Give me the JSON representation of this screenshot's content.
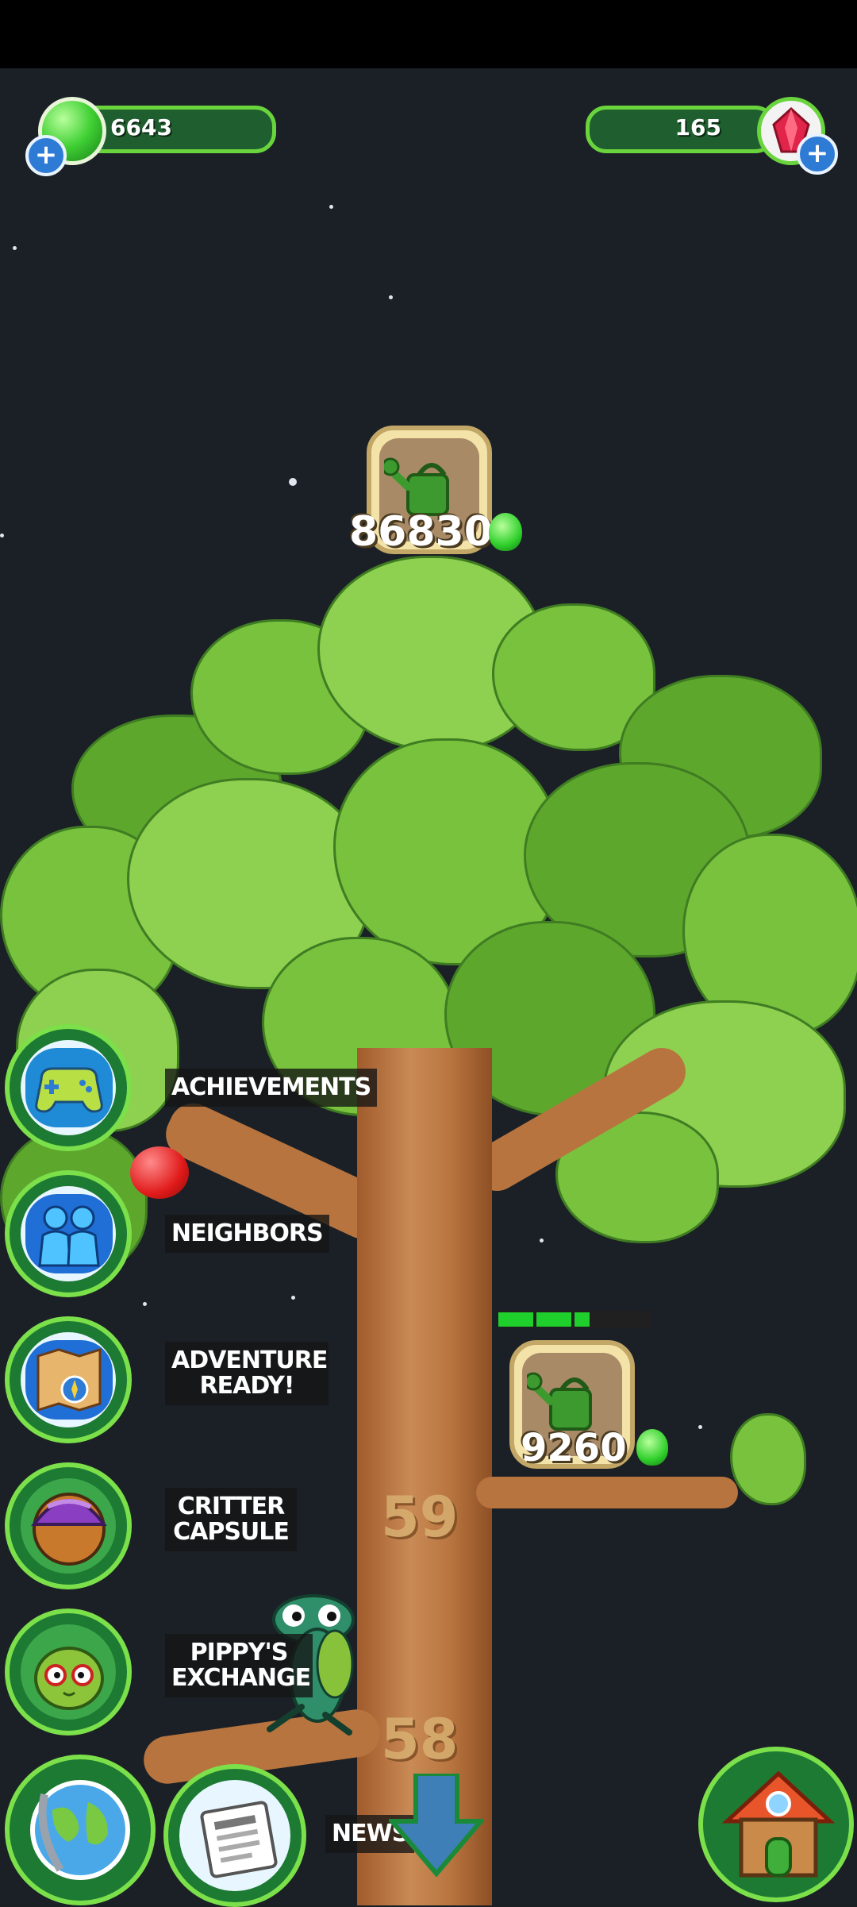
{
  "currencies": {
    "gems_green": {
      "value": "6643",
      "icon": "green-gem-icon",
      "add_icon": "plus-icon"
    },
    "gems_red": {
      "value": "165",
      "icon": "red-crystal-icon",
      "add_icon": "plus-icon"
    }
  },
  "tree": {
    "top_upgrade": {
      "cost": "86830",
      "icon": "watering-can-icon",
      "currency_icon": "green-gem-icon"
    },
    "branch_upgrade": {
      "cost": "9260",
      "icon": "watering-can-icon",
      "currency_icon": "green-gem-icon",
      "progress_fraction": 0.6
    },
    "levels": [
      "59",
      "58"
    ]
  },
  "menu": [
    {
      "id": "achievements",
      "label": "ACHIEVEMENTS",
      "icon": "gamepad-icon"
    },
    {
      "id": "neighbors",
      "label": "NEIGHBORS",
      "icon": "people-icon"
    },
    {
      "id": "adventure",
      "label": "ADVENTURE READY!",
      "icon": "treasure-map-icon"
    },
    {
      "id": "critter_capsule",
      "label": "CRITTER CAPSULE",
      "icon": "capsule-icon"
    },
    {
      "id": "pippys_exchange",
      "label": "PIPPY'S EXCHANGE",
      "icon": "pippy-icon"
    }
  ],
  "bottom": {
    "globe_icon": "globe-icon",
    "news_label": "NEWS",
    "news_icon": "newspaper-icon",
    "home_icon": "house-icon",
    "scroll_icon": "down-arrow-icon"
  },
  "colors": {
    "accent_green": "#6ad43d",
    "currency_bar": "#1f5f2f",
    "sky": "#1b2026"
  }
}
